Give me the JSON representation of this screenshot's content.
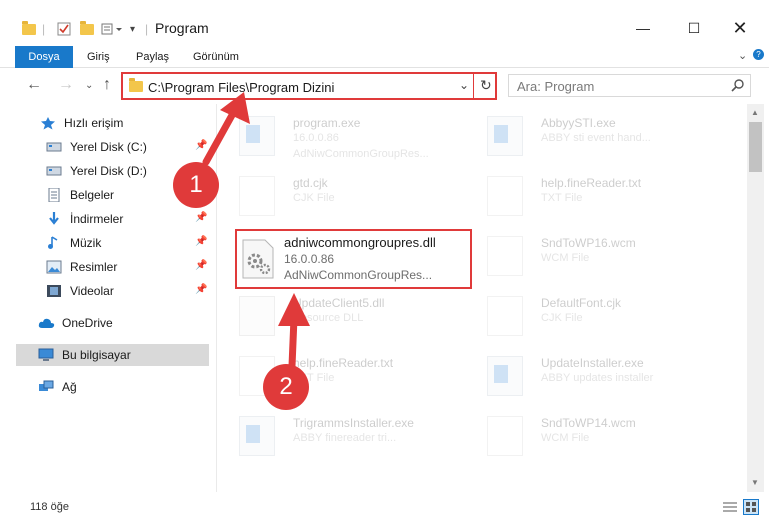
{
  "window": {
    "title": "Program"
  },
  "ribbon": {
    "tabs": [
      "Dosya",
      "Giriş",
      "Paylaş",
      "Görünüm"
    ]
  },
  "address": {
    "path": "C:\\Program Files\\Program Dizini"
  },
  "search": {
    "placeholder": "Ara: Program"
  },
  "sidebar": {
    "items": [
      {
        "label": "Hızlı erişim",
        "icon": "star-icon"
      },
      {
        "label": "Yerel Disk (C:)",
        "icon": "drive-icon"
      },
      {
        "label": "Yerel Disk (D:)",
        "icon": "drive-icon"
      },
      {
        "label": "Belgeler",
        "icon": "documents-icon"
      },
      {
        "label": "İndirmeler",
        "icon": "download-icon"
      },
      {
        "label": "Müzik",
        "icon": "music-icon"
      },
      {
        "label": "Resimler",
        "icon": "pictures-icon"
      },
      {
        "label": "Videolar",
        "icon": "videos-icon"
      },
      {
        "label": "OneDrive",
        "icon": "cloud-icon"
      },
      {
        "label": "Bu bilgisayar",
        "icon": "computer-icon"
      },
      {
        "label": "Ağ",
        "icon": "network-icon"
      }
    ]
  },
  "files": [
    {
      "name": "program.exe",
      "line2": "16.0.0.86",
      "line3": "AdNiwCommonGroupRes...",
      "icon": "exe-icon"
    },
    {
      "name": "AbbyySTI.exe",
      "line2": "ABBY sti event hand...",
      "line3": "",
      "icon": "exe-icon"
    },
    {
      "name": "gtd.cjk",
      "line2": "CJK File",
      "line3": "",
      "icon": "file-icon"
    },
    {
      "name": "help.fineReader.txt",
      "line2": "TXT File",
      "line3": "",
      "icon": "file-icon"
    },
    {
      "name": "adniwcommongroupres.dll",
      "line2": "16.0.0.86",
      "line3": "AdNiwCommonGroupRes...",
      "icon": "dll-icon"
    },
    {
      "name": "SndToWP16.wcm",
      "line2": "WCM File",
      "line3": "",
      "icon": "file-icon"
    },
    {
      "name": "UpdateClient5.dll",
      "line2": "Resource DLL",
      "line3": "",
      "icon": "dll-icon"
    },
    {
      "name": "DefaultFont.cjk",
      "line2": "CJK File",
      "line3": "",
      "icon": "file-icon"
    },
    {
      "name": "help.fineReader.txt",
      "line2": "TXT File",
      "line3": "",
      "icon": "file-icon"
    },
    {
      "name": "UpdateInstaller.exe",
      "line2": "ABBY updates installer",
      "line3": "",
      "icon": "exe-icon"
    },
    {
      "name": "TrigrammsInstaller.exe",
      "line2": "ABBY finereader tri...",
      "line3": "",
      "icon": "exe-icon"
    },
    {
      "name": "SndToWP14.wcm",
      "line2": "WCM File",
      "line3": "",
      "icon": "file-icon"
    }
  ],
  "status": {
    "count": "118 öğe"
  },
  "annotations": {
    "step1": "1",
    "step2": "2"
  },
  "colors": {
    "accent": "#1979ca",
    "annotation": "#e03a3a",
    "folder": "#f3c64b"
  }
}
